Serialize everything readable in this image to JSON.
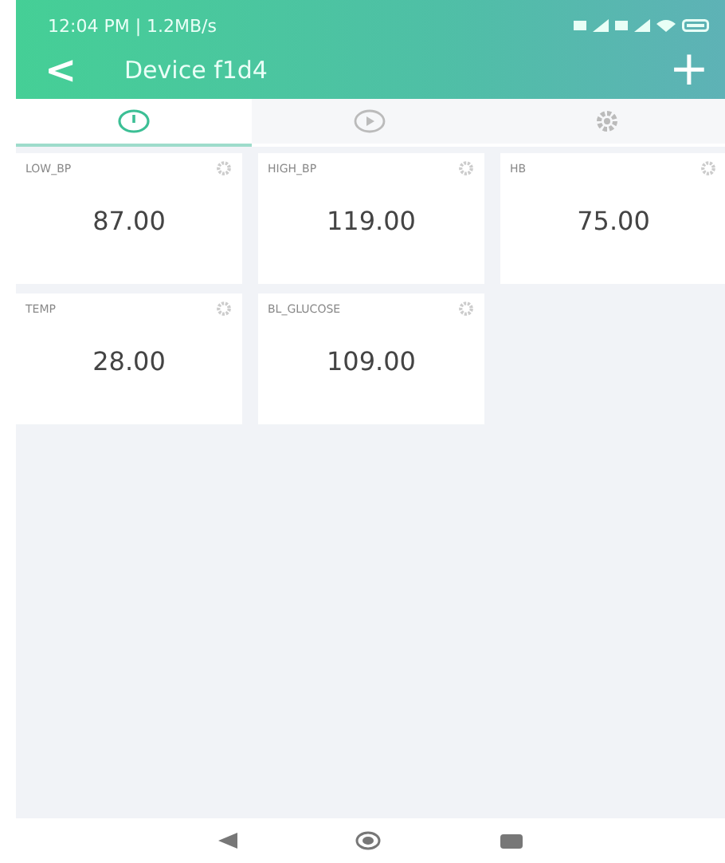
{
  "status_bar": {
    "time": "12:04 PM | 1.2MB/s"
  },
  "header": {
    "back": "<",
    "title": "Device f1d4",
    "add": "+"
  },
  "tabs": [
    {
      "kind": "info",
      "selected": true
    },
    {
      "kind": "play",
      "selected": false
    },
    {
      "kind": "settings",
      "selected": false
    }
  ],
  "widgets": [
    {
      "label": "LOW_BP",
      "value": "87.00"
    },
    {
      "label": "HIGH_BP",
      "value": "119.00"
    },
    {
      "label": "HB",
      "value": "75.00"
    },
    {
      "label": "TEMP",
      "value": "28.00"
    },
    {
      "label": "BL_GLUCOSE",
      "value": "109.00"
    }
  ]
}
